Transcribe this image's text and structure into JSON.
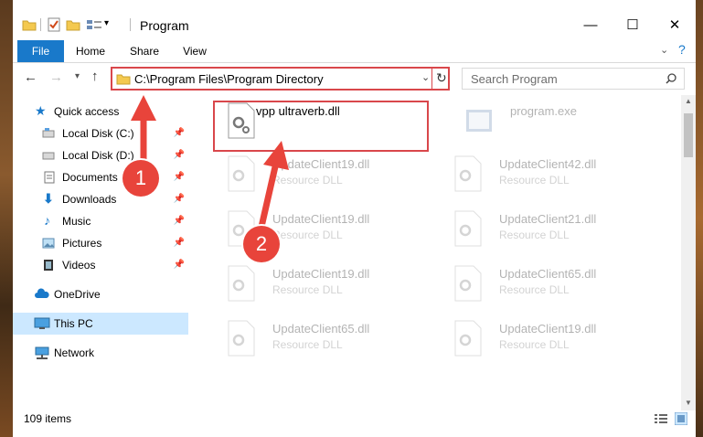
{
  "window": {
    "title": "Program",
    "minimize": "—",
    "maximize": "☐",
    "close": "✕"
  },
  "ribbon": {
    "tabs": [
      "File",
      "Home",
      "Share",
      "View"
    ]
  },
  "nav": {
    "address": "C:\\Program Files\\Program Directory",
    "search_placeholder": "Search Program",
    "back_icon": "arrow-left-icon",
    "forward_icon": "arrow-right-icon",
    "up_icon": "arrow-up-icon"
  },
  "sidebar": {
    "items": [
      {
        "label": "Quick access",
        "icon": "star-icon"
      },
      {
        "label": "Local Disk (C:)",
        "icon": "drive-icon",
        "pinned": true
      },
      {
        "label": "Local Disk (D:)",
        "icon": "drive-icon",
        "pinned": true
      },
      {
        "label": "Documents",
        "icon": "document-icon",
        "pinned": true
      },
      {
        "label": "Downloads",
        "icon": "download-icon",
        "pinned": true
      },
      {
        "label": "Music",
        "icon": "music-icon",
        "pinned": true
      },
      {
        "label": "Pictures",
        "icon": "picture-icon",
        "pinned": true
      },
      {
        "label": "Videos",
        "icon": "video-icon",
        "pinned": true
      },
      {
        "label": "OneDrive",
        "icon": "cloud-icon"
      },
      {
        "label": "This PC",
        "icon": "computer-icon",
        "selected": true
      },
      {
        "label": "Network",
        "icon": "network-icon"
      }
    ]
  },
  "files": {
    "highlighted": {
      "name": "vpp ultraverb.dll"
    },
    "exe": {
      "name": "program.exe"
    },
    "items": [
      {
        "name": "UpdateClient19.dll",
        "desc": "Resource DLL"
      },
      {
        "name": "UpdateClient42.dll",
        "desc": "Resource DLL"
      },
      {
        "name": "UpdateClient19.dll",
        "desc": "Resource DLL"
      },
      {
        "name": "UpdateClient21.dll",
        "desc": "Resource DLL"
      },
      {
        "name": "UpdateClient19.dll",
        "desc": "Resource DLL"
      },
      {
        "name": "UpdateClient65.dll",
        "desc": "Resource DLL"
      },
      {
        "name": "UpdateClient65.dll",
        "desc": "Resource DLL"
      },
      {
        "name": "UpdateClient19.dll",
        "desc": "Resource DLL"
      }
    ]
  },
  "status": {
    "count": "109 items"
  },
  "markers": [
    "1",
    "2"
  ],
  "colors": {
    "accent": "#1979ca",
    "highlight": "#d9474b",
    "marker": "#e8443b",
    "selected_bg": "#cce8ff"
  }
}
